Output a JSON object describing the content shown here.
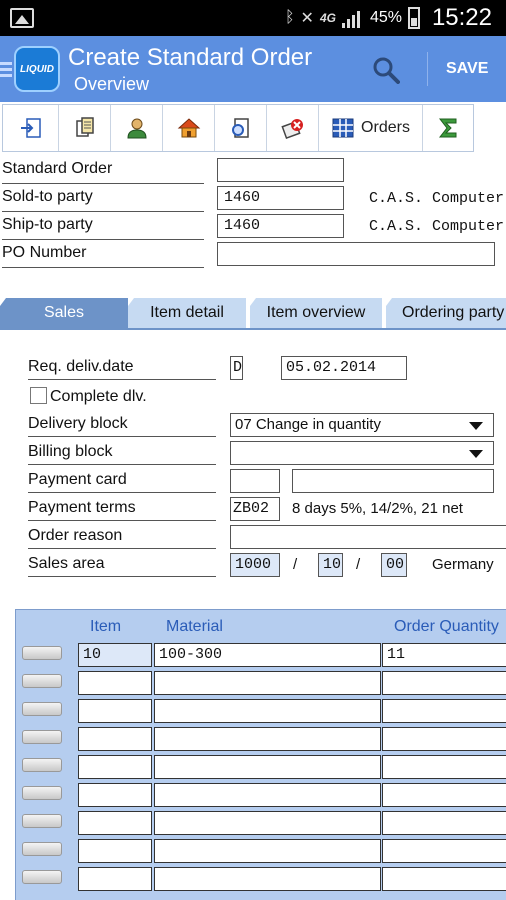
{
  "status_bar": {
    "battery": "45%",
    "network": "4G",
    "time": "15:22"
  },
  "app_bar": {
    "logo_text": "LIQUID",
    "title": "Create Standard Order",
    "subtitle": "Overview",
    "save_label": "SAVE"
  },
  "toolbar": {
    "items": [
      {
        "icon": "enter-document-icon"
      },
      {
        "icon": "documents-icon"
      },
      {
        "icon": "person-icon"
      },
      {
        "icon": "house-icon"
      },
      {
        "icon": "document-search-icon"
      },
      {
        "icon": "delete-icon"
      },
      {
        "icon": "grid-icon",
        "label": "Orders"
      },
      {
        "icon": "sigma-icon"
      }
    ]
  },
  "header_fields": {
    "standard_order": {
      "label": "Standard Order",
      "value": ""
    },
    "sold_to": {
      "label": "Sold-to party",
      "value": "1460",
      "name": "C.A.S. Computer A"
    },
    "ship_to": {
      "label": "Ship-to party",
      "value": "1460",
      "name": "C.A.S. Computer A"
    },
    "po_number": {
      "label": "PO Number",
      "value": ""
    }
  },
  "tabs": [
    {
      "label": "Sales",
      "active": true
    },
    {
      "label": "Item detail",
      "active": false
    },
    {
      "label": "Item overview",
      "active": false
    },
    {
      "label": "Ordering party",
      "active": false
    }
  ],
  "sales": {
    "req_deliv": {
      "label": "Req. deliv.date",
      "type": "D",
      "date": "05.02.2014"
    },
    "complete_dlv": {
      "label": "Complete dlv.",
      "checked": false
    },
    "delivery_block": {
      "label": "Delivery block",
      "value": "07  Change in quantity"
    },
    "billing_block": {
      "label": "Billing block",
      "value": ""
    },
    "payment_card": {
      "label": "Payment card",
      "value1": "",
      "value2": ""
    },
    "payment_terms": {
      "label": "Payment terms",
      "code": "ZB02",
      "text": "8 days 5%, 14/2%, 21 net"
    },
    "order_reason": {
      "label": "Order reason",
      "value": ""
    },
    "sales_area": {
      "label": "Sales area",
      "org": "1000",
      "channel": "10",
      "division": "00",
      "separator": "/",
      "country": "Germany"
    }
  },
  "items_table": {
    "headers": [
      "Item",
      "Material",
      "Order Quantity"
    ],
    "rows": [
      [
        "10",
        "100-300",
        "11"
      ],
      [
        "",
        "",
        ""
      ],
      [
        "",
        "",
        ""
      ],
      [
        "",
        "",
        ""
      ],
      [
        "",
        "",
        ""
      ],
      [
        "",
        "",
        ""
      ],
      [
        "",
        "",
        ""
      ],
      [
        "",
        "",
        ""
      ],
      [
        "",
        "",
        ""
      ]
    ]
  }
}
